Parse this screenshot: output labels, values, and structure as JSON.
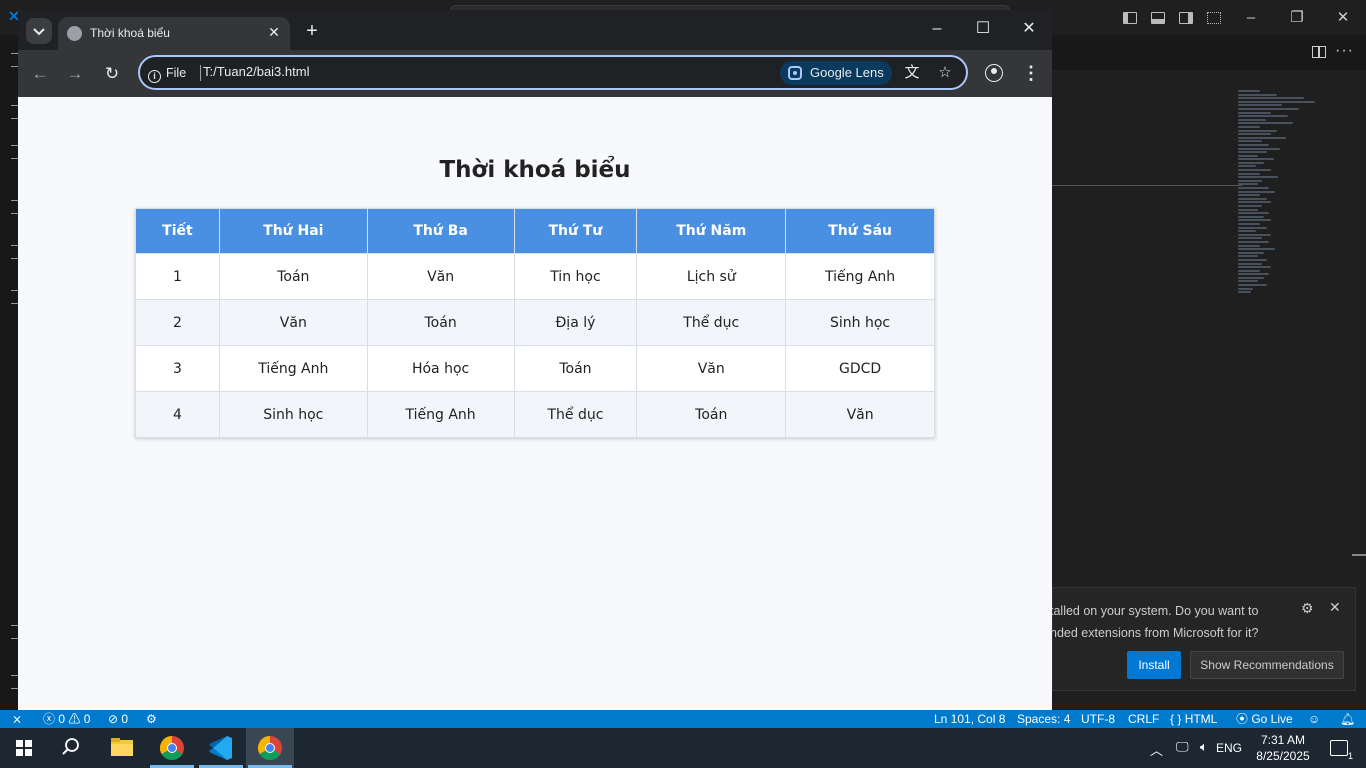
{
  "browser": {
    "tab_title": "Thời khoá biểu",
    "site_info_label": "File",
    "url": "T:/Tuan2/bai3.html",
    "lens_label": "Google Lens"
  },
  "page": {
    "title": "Thời khoá biểu",
    "headers": [
      "Tiết",
      "Thứ Hai",
      "Thứ Ba",
      "Thứ Tư",
      "Thứ Năm",
      "Thứ Sáu"
    ],
    "rows": [
      [
        "1",
        "Toán",
        "Văn",
        "Tin học",
        "Lịch sử",
        "Tiếng Anh"
      ],
      [
        "2",
        "Văn",
        "Toán",
        "Địa lý",
        "Thể dục",
        "Sinh học"
      ],
      [
        "3",
        "Tiếng Anh",
        "Hóa học",
        "Toán",
        "Văn",
        "GDCD"
      ],
      [
        "4",
        "Sinh học",
        "Tiếng Anh",
        "Thể dục",
        "Toán",
        "Văn"
      ]
    ]
  },
  "vscode": {
    "notification": {
      "line1": "talled on your system. Do you want to",
      "line2": "nded extensions from Microsoft for it?",
      "install_label": "Install",
      "recommend_label": "Show Recommendations"
    },
    "status": {
      "errors": "0",
      "warnings": "0",
      "ports": "0",
      "position": "Ln 101, Col 8",
      "spaces": "Spaces: 4",
      "encoding": "UTF-8",
      "eol": "CRLF",
      "language": "HTML",
      "go_live": "Go Live"
    }
  },
  "taskbar": {
    "language": "ENG",
    "time": "7:31 AM",
    "date": "8/25/2025",
    "notif_count": "1"
  },
  "colors": {
    "table_header": "#4a90e2",
    "status_bar": "#007acc",
    "install_button": "#0078d4"
  }
}
